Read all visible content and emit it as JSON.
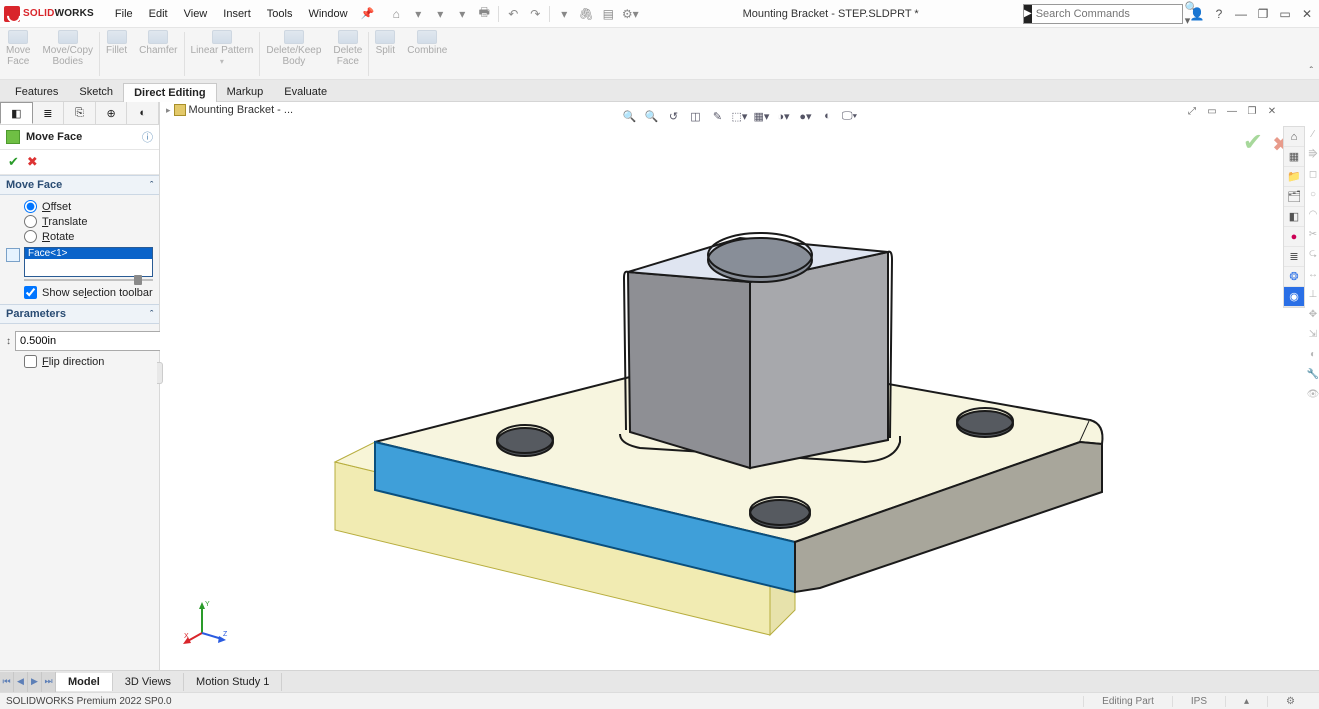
{
  "app": {
    "brand_a": "SOLID",
    "brand_b": "WORKS",
    "title": "Mounting Bracket - STEP.SLDPRT *"
  },
  "menu": {
    "file": "File",
    "edit": "Edit",
    "view": "View",
    "insert": "Insert",
    "tools": "Tools",
    "window": "Window"
  },
  "search": {
    "placeholder": "Search Commands"
  },
  "ribbon": {
    "move_face": "Move\nFace",
    "move_copy": "Move/Copy\nBodies",
    "fillet": "Fillet",
    "chamfer": "Chamfer",
    "linear_pattern": "Linear Pattern",
    "delete_keep": "Delete/Keep\nBody",
    "delete_face": "Delete\nFace",
    "split": "Split",
    "combine": "Combine"
  },
  "cmdtabs": {
    "features": "Features",
    "sketch": "Sketch",
    "direct": "Direct Editing",
    "markup": "Markup",
    "evaluate": "Evaluate"
  },
  "breadcrumb": {
    "item": "Mounting Bracket - ..."
  },
  "pm": {
    "title": "Move Face",
    "section1": "Move Face",
    "offset": "Offset",
    "translate": "Translate",
    "rotate": "Rotate",
    "face_item": "Face<1>",
    "show_sel": "Show selection toolbar",
    "section2": "Parameters",
    "distance": "0.500in",
    "flip": "Flip direction"
  },
  "doctabs": {
    "model": "Model",
    "views": "3D Views",
    "motion": "Motion Study 1"
  },
  "status": {
    "version": "SOLIDWORKS Premium 2022 SP0.0",
    "state": "Editing Part",
    "units": "IPS"
  }
}
